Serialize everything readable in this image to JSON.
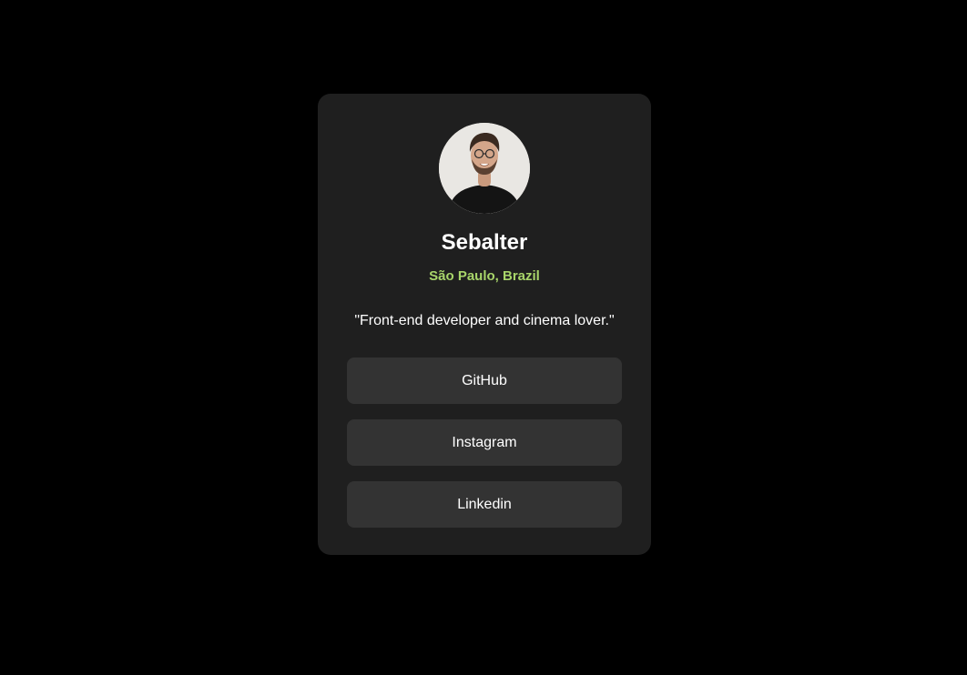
{
  "profile": {
    "name": "Sebalter",
    "location": "São Paulo, Brazil",
    "bio": "\"Front-end developer and cinema lover.\""
  },
  "links": [
    {
      "label": "GitHub"
    },
    {
      "label": "Instagram"
    },
    {
      "label": "Linkedin"
    }
  ],
  "colors": {
    "page_background": "#000000",
    "card_background": "#1f1f1f",
    "button_background": "#333333",
    "accent": "#a8d56a",
    "text": "#ffffff"
  }
}
